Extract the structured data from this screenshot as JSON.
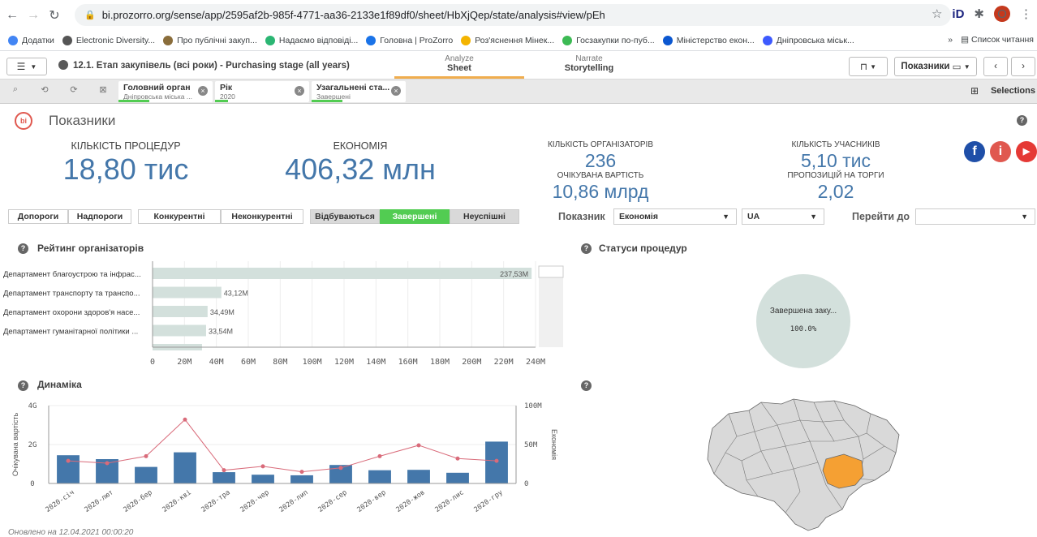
{
  "browser": {
    "url": "bi.prozorro.org/sense/app/2595af2b-985f-4771-aa36-2133e1f89df0/sheet/HbXjQep/state/analysis#view/pEh",
    "avatar_letter": "O"
  },
  "bookmarks": {
    "items": [
      {
        "label": "Додатки",
        "color": "#4285f4"
      },
      {
        "label": "Electronic Diversity...",
        "color": "#555555"
      },
      {
        "label": "Про публічні закуп...",
        "color": "#8a6d3b"
      },
      {
        "label": "Надаємо відповіді...",
        "color": "#2bb673"
      },
      {
        "label": "Головна | ProZorro",
        "color": "#1a73e8"
      },
      {
        "label": "Роз'яснення Мінек...",
        "color": "#f4b400"
      },
      {
        "label": "Госзакупки по-пуб...",
        "color": "#3cba54"
      },
      {
        "label": "Міністерство екон...",
        "color": "#0b57d0"
      },
      {
        "label": "Дніпровська міськ...",
        "color": "#3d5afe"
      }
    ],
    "more": "»",
    "reading_list": "Список читання"
  },
  "toolbar": {
    "app_title": "12.1. Етап закупівель (всі роки) - Purchasing stage (all years)",
    "analyze_sub": "Analyze",
    "analyze_main": "Sheet",
    "narrate_sub": "Narrate",
    "narrate_main": "Storytelling",
    "sheet_select": "Показники"
  },
  "selections": {
    "chips": [
      {
        "title": "Головний орган",
        "value": "Дніпровська міська ..."
      },
      {
        "title": "Рік",
        "value": "2020"
      },
      {
        "title": "Узагальнені ста...",
        "value": "Завершені"
      }
    ],
    "label": "Selections"
  },
  "sheet": {
    "title": "Показники"
  },
  "kpis": {
    "procedures_label": "КІЛЬКІСТЬ ПРОЦЕДУР",
    "procedures_value": "18,80 тис",
    "economy_label": "ЕКОНОМІЯ",
    "economy_value": "406,32 млн",
    "organizers_label": "КІЛЬКІСТЬ ОРГАНІЗАТОРІВ",
    "organizers_value": "236",
    "expected_label": "ОЧІКУВАНА ВАРТІСТЬ",
    "expected_value": "10,86 млрд",
    "participants_label": "КІЛЬКІСТЬ УЧАСНИКІВ",
    "participants_value": "5,10 тис",
    "bids_label": "ПРОПОЗИЦІЙ НА ТОРГИ",
    "bids_value": "2,02"
  },
  "filters": {
    "buttons": [
      "Допороги",
      "Надпороги",
      "Конкурентні",
      "Неконкурентні",
      "Відбуваються",
      "Завершені",
      "Неуспішні"
    ],
    "indicator_label": "Показник",
    "indicator_value": "Економія",
    "currency_value": "UA",
    "goto_label": "Перейти до",
    "goto_value": ""
  },
  "rating": {
    "title": "Рейтинг організаторів",
    "x_ticks": [
      "0",
      "20M",
      "40M",
      "60M",
      "80M",
      "100M",
      "120M",
      "140M",
      "160M",
      "180M",
      "200M",
      "220M",
      "240M"
    ]
  },
  "statuses": {
    "title": "Статуси процедур",
    "slice_label": "Завершена заку...",
    "slice_percent": "100.0%"
  },
  "dynamics": {
    "title": "Динаміка",
    "y_left_label": "Очікувана вартість",
    "y_right_label": "Економія",
    "y_left_ticks": [
      "4G",
      "2G",
      "0"
    ],
    "y_right_ticks": [
      "100M",
      "50M",
      "0"
    ]
  },
  "map": {
    "highlight_color": "#f5a033"
  },
  "footnote": "Оновлено на 12.04.2021 00:00:20",
  "chart_data": [
    {
      "type": "bar",
      "orientation": "horizontal",
      "categories": [
        "Департамент благоустрою та інфрас...",
        "Департамент транспорту та транспо...",
        "Департамент охорони здоров'я насе...",
        "Департамент гуманітарної політики ...",
        ""
      ],
      "values": [
        237.53,
        43.12,
        34.49,
        33.54,
        31
      ],
      "value_labels": [
        "237,53M",
        "43,12M",
        "34,49M",
        "33,54M",
        ""
      ],
      "xlim": [
        0,
        240
      ],
      "grid": true,
      "color": "#d3e0dc"
    },
    {
      "type": "pie",
      "categories": [
        "Завершена заку..."
      ],
      "values": [
        100
      ],
      "color": "#d3e0dc"
    },
    {
      "type": "bar+line",
      "categories": [
        "2020-січ",
        "2020-лют",
        "2020-бер",
        "2020-кві",
        "2020-тра",
        "2020-чер",
        "2020-лип",
        "2020-сер",
        "2020-вер",
        "2020-жов",
        "2020-лис",
        "2020-гру"
      ],
      "series": [
        {
          "name": "Очікувана вартість",
          "type": "bar",
          "axis": "left",
          "values": [
            1.45,
            1.25,
            0.85,
            1.6,
            0.58,
            0.45,
            0.42,
            0.95,
            0.68,
            0.7,
            0.55,
            2.15
          ],
          "color": "#4477aa"
        },
        {
          "name": "Економія",
          "type": "line",
          "axis": "right",
          "values": [
            29,
            26,
            35,
            82,
            17,
            22,
            15,
            20,
            35,
            49,
            32,
            29
          ],
          "color": "#d96b7a"
        }
      ],
      "ylim_left": [
        0,
        4
      ],
      "ylim_right": [
        0,
        100
      ],
      "grid": true
    }
  ]
}
